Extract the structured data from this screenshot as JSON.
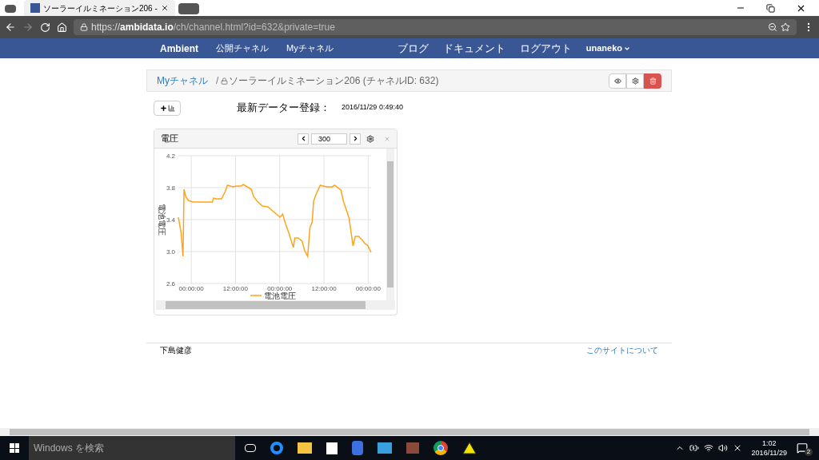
{
  "browser": {
    "tabs": [
      {
        "title": "ソーラーイルミネーション206 -",
        "selected": true
      }
    ],
    "url": {
      "scheme": "https://",
      "host": "ambidata.io",
      "path": "/ch/channel.html?id=632&private=true"
    }
  },
  "navbar": {
    "brand": "Ambient",
    "left_links": [
      "公開チャネル",
      "Myチャネル"
    ],
    "right_links": [
      "ブログ",
      "ドキュメント",
      "ログアウト"
    ],
    "user": "unaneko"
  },
  "breadcrumb": {
    "parent": "Myチャネル",
    "separator": "/",
    "locked": true,
    "current": "ソーラーイルミネーション206 (チャネルID: 632)"
  },
  "last_update": {
    "label": "最新データー登録：",
    "value": "2016/11/29 0:49:40"
  },
  "chart_card": {
    "title": "電圧",
    "range": "300",
    "chart_data": {
      "type": "line",
      "ylabel": "電池電圧",
      "grid": true,
      "xlim": [
        "2016-11-26T20:30:00",
        "2016-11-29T00:48:00"
      ],
      "ylim": [
        2.6,
        4.2
      ],
      "xticks": [
        {
          "value": "2016-11-27T00:00:00",
          "label": "00:00:00"
        },
        {
          "value": "2016-11-27T12:00:00",
          "label": "12:00:00"
        },
        {
          "value": "2016-11-28T00:00:00",
          "label": "00:00:00"
        },
        {
          "value": "2016-11-28T12:00:00",
          "label": "12:00:00"
        },
        {
          "value": "2016-11-29T00:00:00",
          "label": "00:00:00"
        }
      ],
      "yticks": [
        {
          "value": 2.6,
          "label": "2.6"
        },
        {
          "value": 3.0,
          "label": "3.0"
        },
        {
          "value": 3.4,
          "label": "3.4"
        },
        {
          "value": 3.8,
          "label": "3.8"
        },
        {
          "value": 4.2,
          "label": "4.2"
        }
      ],
      "x": [
        "2016-11-26T20:30:00",
        "2016-11-26T21:15:00",
        "2016-11-26T21:46:00",
        "2016-11-26T22:03:00",
        "2016-11-26T22:30:00",
        "2016-11-26T23:12:00",
        "2016-11-27T00:30:00",
        "2016-11-27T05:42:00",
        "2016-11-27T06:06:00",
        "2016-11-27T06:36:00",
        "2016-11-27T08:12:00",
        "2016-11-27T09:12:00",
        "2016-11-27T09:48:00",
        "2016-11-27T11:24:00",
        "2016-11-27T12:12:00",
        "2016-11-27T13:30:00",
        "2016-11-27T14:06:00",
        "2016-11-27T16:18:00",
        "2016-11-27T16:54:00",
        "2016-11-27T17:54:00",
        "2016-11-27T19:18:00",
        "2016-11-27T20:48:00",
        "2016-11-27T22:18:00",
        "2016-11-28T00:06:00",
        "2016-11-28T00:48:00",
        "2016-11-28T01:30:00",
        "2016-11-28T02:30:00",
        "2016-11-28T03:42:00",
        "2016-11-28T04:06:00",
        "2016-11-28T05:00:00",
        "2016-11-28T06:06:00",
        "2016-11-28T06:42:00",
        "2016-11-28T07:36:00",
        "2016-11-28T08:12:00",
        "2016-11-28T08:48:00",
        "2016-11-28T09:12:00",
        "2016-11-28T09:54:00",
        "2016-11-28T11:00:00",
        "2016-11-28T12:42:00",
        "2016-11-28T14:12:00",
        "2016-11-28T14:54:00",
        "2016-11-28T16:36:00",
        "2016-11-28T17:18:00",
        "2016-11-28T18:48:00",
        "2016-11-28T19:54:00",
        "2016-11-28T20:30:00",
        "2016-11-28T21:24:00",
        "2016-11-28T22:30:00",
        "2016-11-28T23:06:00",
        "2016-11-28T23:48:00",
        "2016-11-29T00:48:00"
      ],
      "series": [
        {
          "name": "電池電圧",
          "color": "#ffa31a",
          "values": [
            3.43,
            3.23,
            2.94,
            3.78,
            3.69,
            3.64,
            3.62,
            3.62,
            3.67,
            3.66,
            3.66,
            3.75,
            3.83,
            3.81,
            3.82,
            3.82,
            3.84,
            3.78,
            3.69,
            3.63,
            3.57,
            3.56,
            3.5,
            3.43,
            3.47,
            3.36,
            3.23,
            3.05,
            3.17,
            3.17,
            3.13,
            3.02,
            2.94,
            3.3,
            3.37,
            3.63,
            3.72,
            3.83,
            3.81,
            3.81,
            3.83,
            3.77,
            3.63,
            3.42,
            3.07,
            3.19,
            3.19,
            3.14,
            3.1,
            3.08,
            2.99
          ]
        }
      ]
    }
  },
  "footer": {
    "author": "下島健彦",
    "link": "このサイトについて"
  },
  "taskbar": {
    "search_placeholder": "Windows を検索",
    "time": "1:02",
    "date": "2016/11/29",
    "notifications": "2"
  }
}
